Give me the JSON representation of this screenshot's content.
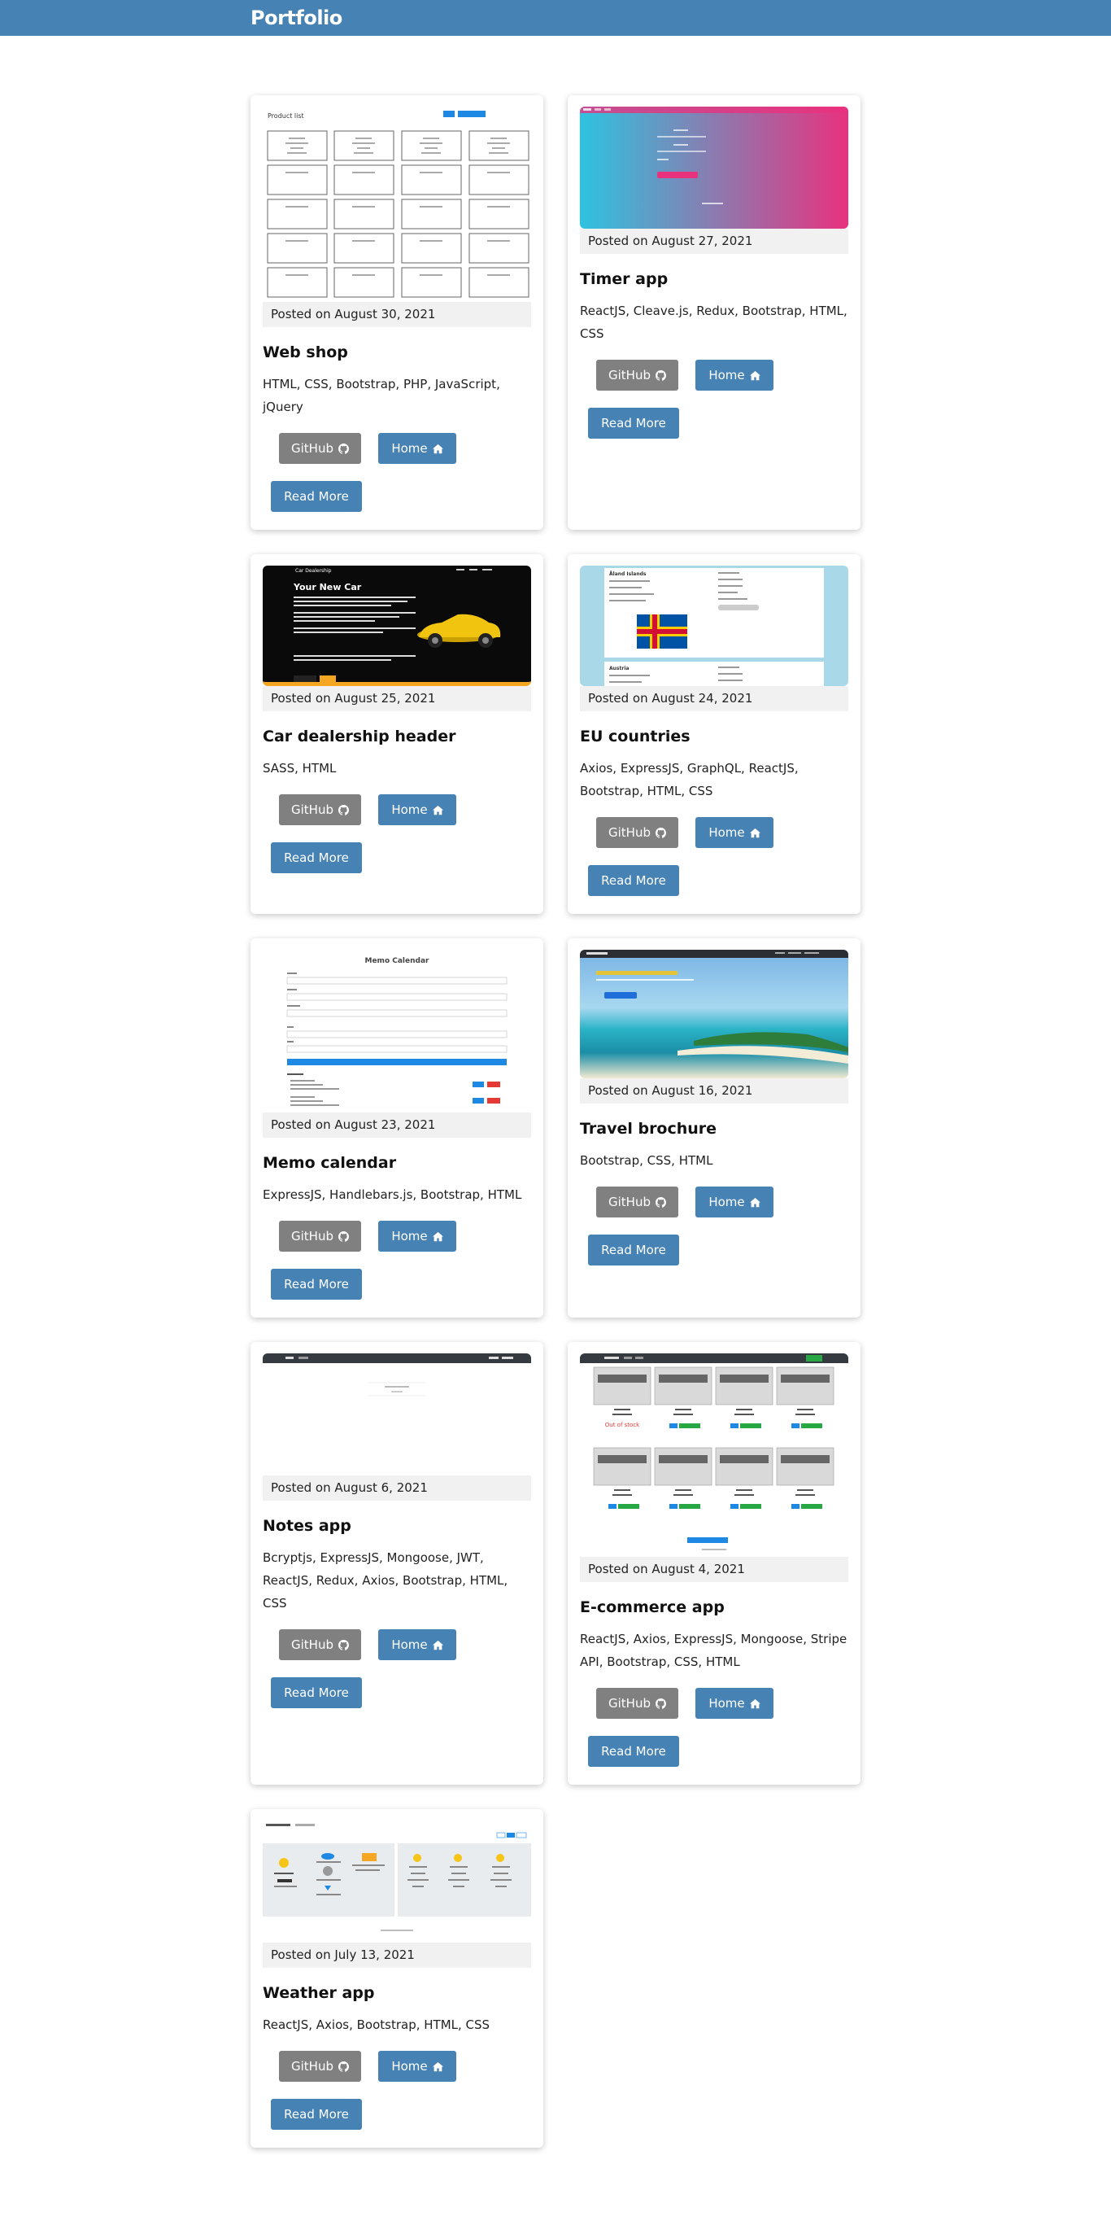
{
  "header": {
    "brand": "Portfolio"
  },
  "buttons": {
    "github": "GitHub",
    "home": "Home",
    "read_more": "Read More"
  },
  "projects": [
    {
      "title": "Web shop",
      "posted": "Posted on August 30, 2021",
      "tech": "HTML, CSS, Bootstrap, PHP, JavaScript, jQuery",
      "thumb": {
        "heading": "Product list"
      }
    },
    {
      "title": "Timer app",
      "posted": "Posted on August 27, 2021",
      "tech": "ReactJS, Cleave.js, Redux, Bootstrap, HTML, CSS"
    },
    {
      "title": "Car dealership header",
      "posted": "Posted on August 25, 2021",
      "tech": "SASS, HTML",
      "thumb": {
        "brand": "Car Dealership",
        "heading": "Your New Car"
      }
    },
    {
      "title": "EU countries",
      "posted": "Posted on August 24, 2021",
      "tech": "Axios, ExpressJS, GraphQL, ReactJS, Bootstrap, HTML, CSS",
      "thumb": {
        "country1": "Åland Islands",
        "country2": "Austria"
      }
    },
    {
      "title": "Memo calendar",
      "posted": "Posted on August 23, 2021",
      "tech": "ExpressJS, Handlebars.js, Bootstrap, HTML",
      "thumb": {
        "heading": "Memo Calendar"
      }
    },
    {
      "title": "Travel brochure",
      "posted": "Posted on August 16, 2021",
      "tech": "Bootstrap, CSS, HTML"
    },
    {
      "title": "Notes app",
      "posted": "Posted on August 6, 2021",
      "tech": "Bcryptjs, ExpressJS, Mongoose, JWT, ReactJS, Redux, Axios, Bootstrap, HTML, CSS"
    },
    {
      "title": "E-commerce app",
      "posted": "Posted on August 4, 2021",
      "tech": "ReactJS, Axios, ExpressJS, Mongoose, Stripe API, Bootstrap, CSS, HTML",
      "thumb": {
        "out_of_stock": "Out of stock"
      }
    },
    {
      "title": "Weather app",
      "posted": "Posted on July 13, 2021",
      "tech": "ReactJS, Axios, Bootstrap, HTML, CSS"
    }
  ],
  "icons": {
    "github": "github-icon",
    "home": "home-icon"
  },
  "colors": {
    "header": "#4682b4",
    "primary_button": "#4682b4",
    "github_button": "#808080",
    "posted_bg": "#f1f1f1"
  }
}
